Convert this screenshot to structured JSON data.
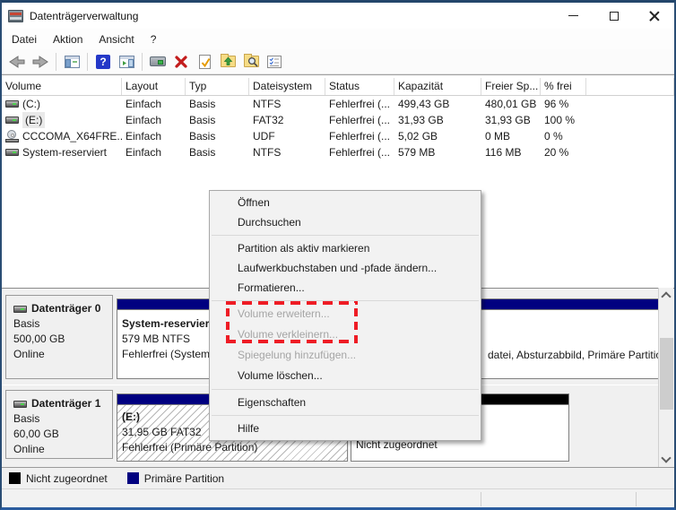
{
  "window": {
    "title": "Datenträgerverwaltung"
  },
  "menubar": {
    "items": [
      {
        "label": "Datei"
      },
      {
        "label": "Aktion"
      },
      {
        "label": "Ansicht"
      },
      {
        "label": "?"
      }
    ]
  },
  "toolbar": {
    "icons": [
      "back-icon",
      "forward-icon",
      "console-tree-icon",
      "help-icon",
      "action-pane-icon",
      "remote-computer-icon",
      "delete-icon",
      "check-document-icon",
      "folder-up-icon",
      "folder-search-icon",
      "checklist-icon"
    ]
  },
  "table": {
    "columns": [
      {
        "label": "Volume"
      },
      {
        "label": "Layout"
      },
      {
        "label": "Typ"
      },
      {
        "label": "Dateisystem"
      },
      {
        "label": "Status"
      },
      {
        "label": "Kapazität"
      },
      {
        "label": "Freier Sp..."
      },
      {
        "label": "% frei"
      }
    ],
    "rows": [
      {
        "volume": "(C:)",
        "layout": "Einfach",
        "typ": "Basis",
        "dateisystem": "NTFS",
        "status": "Fehlerfrei (...",
        "kapazitaet": "499,43 GB",
        "freier_sp": "480,01 GB",
        "prozent_frei": "96 %"
      },
      {
        "volume": "(E:)",
        "layout": "Einfach",
        "typ": "Basis",
        "dateisystem": "FAT32",
        "status": "Fehlerfrei (...",
        "kapazitaet": "31,93 GB",
        "freier_sp": "31,93 GB",
        "prozent_frei": "100 %"
      },
      {
        "volume": "CCCOMA_X64FRE...",
        "layout": "Einfach",
        "typ": "Basis",
        "dateisystem": "UDF",
        "status": "Fehlerfrei (...",
        "kapazitaet": "5,02 GB",
        "freier_sp": "0 MB",
        "prozent_frei": "0 %"
      },
      {
        "volume": "System-reserviert",
        "layout": "Einfach",
        "typ": "Basis",
        "dateisystem": "NTFS",
        "status": "Fehlerfrei (...",
        "kapazitaet": "579 MB",
        "freier_sp": "116 MB",
        "prozent_frei": "20 %"
      }
    ]
  },
  "context_menu": {
    "items": [
      {
        "label": "Öffnen",
        "enabled": true
      },
      {
        "label": "Durchsuchen",
        "enabled": true
      },
      {
        "label": "Partition als aktiv markieren",
        "enabled": true
      },
      {
        "label": "Laufwerkbuchstaben und -pfade ändern...",
        "enabled": true
      },
      {
        "label": "Formatieren...",
        "enabled": true
      },
      {
        "label": "Volume erweitern...",
        "enabled": false
      },
      {
        "label": "Volume verkleinern...",
        "enabled": false
      },
      {
        "label": "Spiegelung hinzufügen...",
        "enabled": false
      },
      {
        "label": "Volume löschen...",
        "enabled": true
      },
      {
        "label": "Eigenschaften",
        "enabled": true
      },
      {
        "label": "Hilfe",
        "enabled": true
      }
    ],
    "highlighted_items": [
      "Volume erweitern...",
      "Volume verkleinern..."
    ]
  },
  "disks": [
    {
      "name": "Datenträger 0",
      "type": "Basis",
      "size": "500,00 GB",
      "status": "Online",
      "partitions": [
        {
          "title": "System-reserviert",
          "line2": "579 MB NTFS",
          "line3": "Fehlerfrei (System"
        },
        {
          "line3_fragment": "datei, Absturzabbild, Primäre Partition)"
        }
      ]
    },
    {
      "name": "Datenträger 1",
      "type": "Basis",
      "size": "60,00 GB",
      "status": "Online",
      "partitions": [
        {
          "title": "(E:)",
          "line2": "31,95 GB FAT32",
          "line3": "Fehlerfrei (Primäre Partition)"
        },
        {
          "label": "Nicht zugeordnet"
        }
      ]
    }
  ],
  "legend": {
    "items": [
      {
        "label": "Nicht zugeordnet",
        "color": "#000000"
      },
      {
        "label": "Primäre Partition",
        "color": "#000080"
      }
    ]
  },
  "colors": {
    "primary_partition": "#000080",
    "unallocated": "#000000",
    "highlight_red": "#ee1c25",
    "window_border": "#2a4d74"
  }
}
